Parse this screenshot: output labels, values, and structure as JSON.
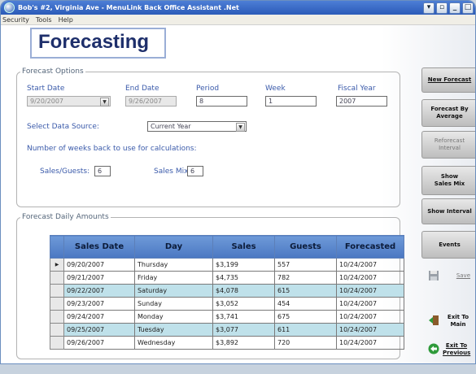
{
  "window": {
    "title": "Bob's #2, Virginia Ave - MenuLink Back Office Assistant .Net"
  },
  "menu": [
    "Security",
    "Tools",
    "Help"
  ],
  "page_title": "Forecasting",
  "options": {
    "legend": "Forecast Options",
    "start_date_label": "Start Date",
    "start_date": "9/20/2007",
    "end_date_label": "End Date",
    "end_date": "9/26/2007",
    "period_label": "Period",
    "period": "8",
    "week_label": "Week",
    "week": "1",
    "fiscal_year_label": "Fiscal Year",
    "fiscal_year": "2007",
    "data_source_label": "Select Data Source:",
    "data_source": "Current Year",
    "weeks_back_label": "Number of weeks back to use for calculations:",
    "sales_guests_label": "Sales/Guests:",
    "sales_guests": "6",
    "sales_mix_label": "Sales Mix:",
    "sales_mix": "6"
  },
  "daily": {
    "legend": "Forecast Daily Amounts",
    "columns": [
      "Sales Date",
      "Day",
      "Sales",
      "Guests",
      "Forecasted"
    ],
    "rows": [
      [
        "09/20/2007",
        "Thursday",
        "$3,199",
        "557",
        "10/24/2007"
      ],
      [
        "09/21/2007",
        "Friday",
        "$4,735",
        "782",
        "10/24/2007"
      ],
      [
        "09/22/2007",
        "Saturday",
        "$4,078",
        "615",
        "10/24/2007"
      ],
      [
        "09/23/2007",
        "Sunday",
        "$3,052",
        "454",
        "10/24/2007"
      ],
      [
        "09/24/2007",
        "Monday",
        "$3,741",
        "675",
        "10/24/2007"
      ],
      [
        "09/25/2007",
        "Tuesday",
        "$3,077",
        "611",
        "10/24/2007"
      ],
      [
        "09/26/2007",
        "Wednesday",
        "$3,892",
        "720",
        "10/24/2007"
      ]
    ]
  },
  "buttons": {
    "new_forecast": "New Forecast",
    "forecast_by_average": "Forecast By Average",
    "reforecast_interval": "Reforecast Interval",
    "show_sales_mix": "Show Sales Mix",
    "show_interval": "Show Interval",
    "events": "Events",
    "save": "Save",
    "exit_main": "Exit To Main",
    "exit_previous": "Exit To Previous"
  }
}
